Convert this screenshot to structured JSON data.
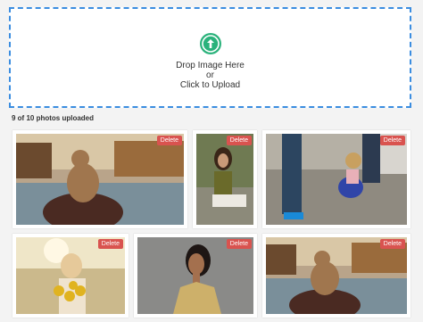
{
  "dropzone": {
    "line1": "Drop Image Here",
    "line2": "or",
    "line3": "Click to Upload",
    "icon": "upload-arrow-icon",
    "accent_color": "#2ab27b",
    "border_color": "#3b8de0"
  },
  "status": {
    "text": "9 of 10 photos uploaded"
  },
  "delete_label": "Delete",
  "delete_color": "#d9534f",
  "photos": [
    {
      "subject": "woman-by-canal"
    },
    {
      "subject": "woman-sitting-on-steps"
    },
    {
      "subject": "child-on-steps-with-adults"
    },
    {
      "subject": "girl-with-sunflowers"
    },
    {
      "subject": "woman-portrait"
    },
    {
      "subject": "woman-by-canal"
    }
  ]
}
